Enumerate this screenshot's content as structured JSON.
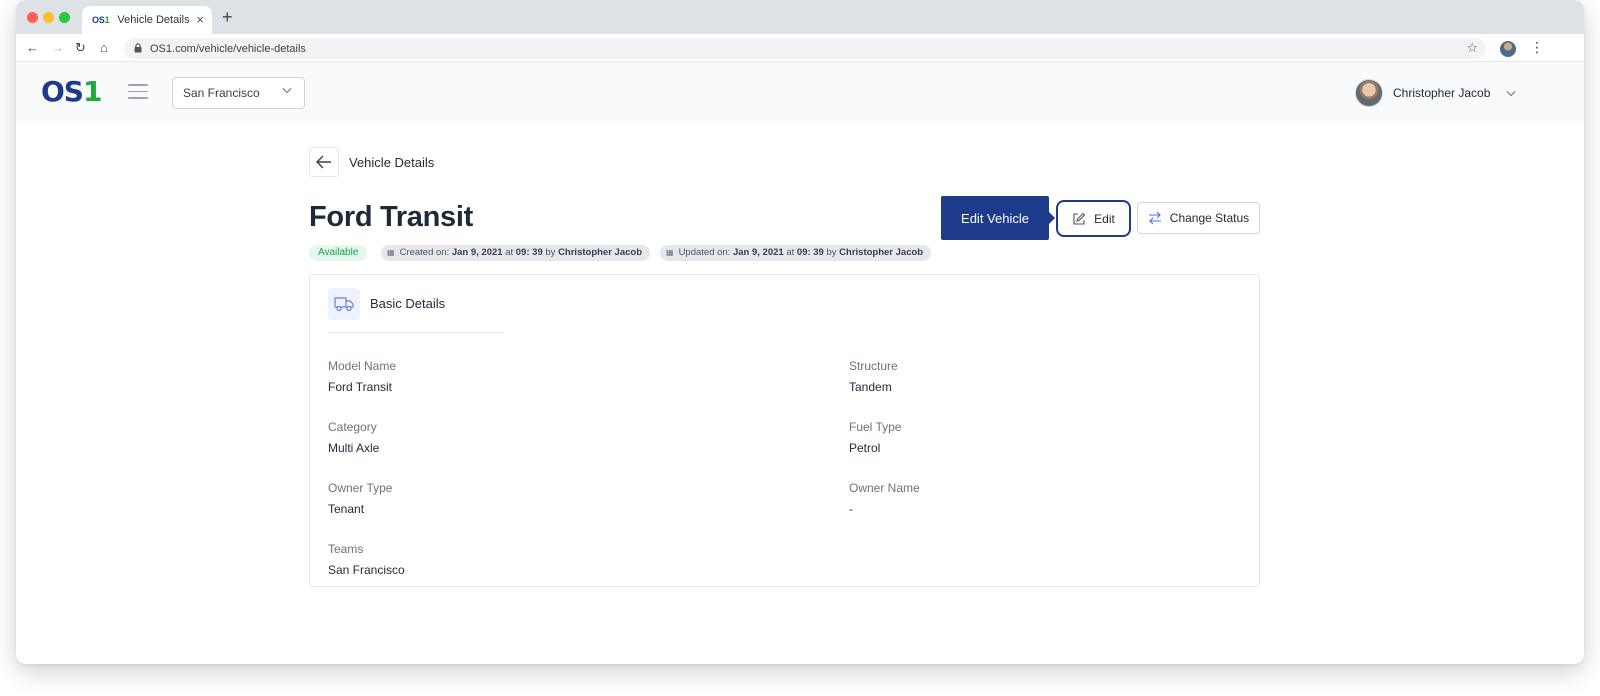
{
  "browser": {
    "tab_favicon_os": "OS",
    "tab_favicon_one": "1",
    "tab_title": "Vehicle Details",
    "tab_close": "×",
    "new_tab": "+",
    "url": "OS1.com/vehicle/vehicle-details"
  },
  "header": {
    "logo_os": "OS",
    "logo_one": "1",
    "city": "San Francisco",
    "user_name": "Christopher Jacob"
  },
  "page": {
    "breadcrumb": "Vehicle Details",
    "title": "Ford Transit",
    "status": "Available",
    "created": {
      "prefix": "Created on:",
      "date": "Jan 9, 2021",
      "at": "at",
      "time": "09: 39",
      "by": "by",
      "user": "Christopher Jacob"
    },
    "updated": {
      "prefix": "Updated on:",
      "date": "Jan 9, 2021",
      "at": "at",
      "time": "09: 39",
      "by": "by",
      "user": "Christopher Jacob"
    },
    "actions": {
      "edit_vehicle": "Edit Vehicle",
      "edit": "Edit",
      "change_status": "Change Status"
    }
  },
  "card": {
    "title": "Basic Details",
    "fields": [
      {
        "label": "Model Name",
        "value": "Ford Transit"
      },
      {
        "label": "Structure",
        "value": "Tandem"
      },
      {
        "label": "Category",
        "value": "Multi Axle"
      },
      {
        "label": "Fuel Type",
        "value": "Petrol"
      },
      {
        "label": "Owner Type",
        "value": "Tenant"
      },
      {
        "label": "Owner Name",
        "value": "-"
      },
      {
        "label": "Teams",
        "value": "San Francisco"
      }
    ]
  },
  "colors": {
    "brand_navy": "#1e3a8a",
    "brand_green": "#22a83a",
    "status_green": "#16a34a"
  },
  "icons": [
    "back-arrow-icon",
    "hamburger-icon",
    "chevron-down-icon",
    "pencil-icon",
    "swap-arrows-icon",
    "truck-icon",
    "calendar-icon",
    "lock-icon",
    "star-icon"
  ]
}
